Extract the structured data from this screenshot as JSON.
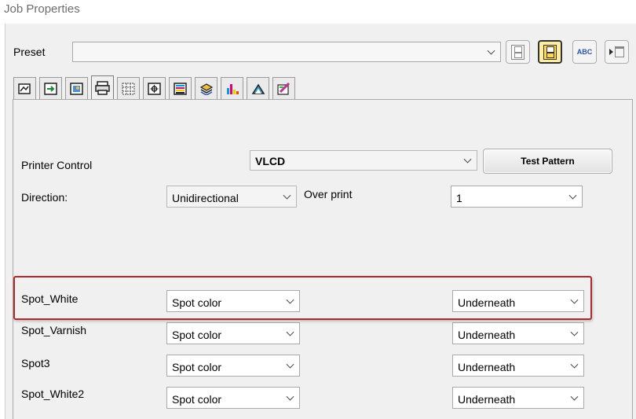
{
  "window": {
    "title": "Job Properties"
  },
  "preset": {
    "label": "Preset",
    "value": ""
  },
  "toolbar": {
    "buttons": [
      {
        "name": "save",
        "icon": "save-disk-icon"
      },
      {
        "name": "save-as",
        "icon": "save-disk-yellow-icon"
      },
      {
        "name": "rename",
        "icon": "abc-rename-icon",
        "text": "ABC"
      },
      {
        "name": "delete",
        "icon": "trash-icon"
      }
    ]
  },
  "tabs": [
    {
      "icon": "media-icon"
    },
    {
      "icon": "layout-icon"
    },
    {
      "icon": "image-icon"
    },
    {
      "icon": "printer-icon",
      "active": true
    },
    {
      "icon": "tiling-icon"
    },
    {
      "icon": "marks-icon"
    },
    {
      "icon": "color-bars-icon"
    },
    {
      "icon": "layers-icon"
    },
    {
      "icon": "channels-icon"
    },
    {
      "icon": "profile-icon"
    },
    {
      "icon": "color-edit-icon"
    }
  ],
  "printer_control": {
    "label": "Printer Control",
    "value": "VLCD",
    "test_pattern_label": "Test Pattern"
  },
  "direction": {
    "label": "Direction:",
    "value": "Unidirectional"
  },
  "over_print": {
    "label": "Over print",
    "value": "1"
  },
  "spot_rows": [
    {
      "name": "Spot_White",
      "type": "Spot color",
      "placement": "Underneath"
    },
    {
      "name": "Spot_Varnish",
      "type": "Spot color",
      "placement": "Underneath"
    },
    {
      "name": "Spot3",
      "type": "Spot color",
      "placement": "Underneath"
    },
    {
      "name": "Spot_White2",
      "type": "Spot color",
      "placement": "Underneath"
    }
  ],
  "colors": {
    "highlight": "#b02a2a",
    "active_button": "#ffd94a"
  }
}
